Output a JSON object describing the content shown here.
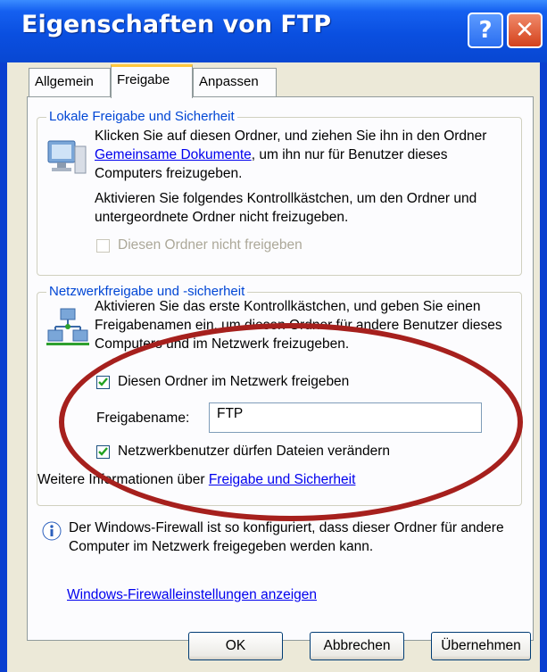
{
  "window": {
    "title": "Eigenschaften von FTP",
    "help_label": "?",
    "close_label": "✕"
  },
  "tabs": [
    {
      "label": "Allgemein",
      "active": false
    },
    {
      "label": "Freigabe",
      "active": true
    },
    {
      "label": "Anpassen",
      "active": false
    }
  ],
  "local_group": {
    "legend": "Lokale Freigabe und Sicherheit",
    "para1_before": "Klicken Sie auf diesen Ordner, und ziehen Sie ihn in den Ordner ",
    "para1_link": "Gemeinsame Dokumente",
    "para1_after": ", um ihn nur für Benutzer dieses Computers freizugeben.",
    "para2": "Aktivieren Sie folgendes Kontrollkästchen, um den Ordner und untergeordnete Ordner nicht freizugeben.",
    "checkbox_label": "Diesen Ordner nicht freigeben",
    "checkbox_checked": false,
    "checkbox_disabled": true
  },
  "network_group": {
    "legend": "Netzwerkfreigabe und -sicherheit",
    "para": "Aktivieren Sie das erste Kontrollkästchen, und geben Sie einen Freigabenamen ein, um diesen Ordner für andere Benutzer dieses Computers und im Netzwerk freizugeben.",
    "share_checkbox_label": "Diesen Ordner im Netzwerk freigeben",
    "share_checked": true,
    "share_name_label": "Freigabename:",
    "share_name_value": "FTP",
    "modify_checkbox_label": "Netzwerkbenutzer dürfen Dateien verändern",
    "modify_checked": true,
    "more_info_prefix": "Weitere Informationen über ",
    "more_info_link": "Freigabe und Sicherheit"
  },
  "firewall": {
    "info_text": "Der Windows-Firewall ist so konfiguriert, dass dieser Ordner für andere Computer im Netzwerk freigegeben werden kann.",
    "settings_link": "Windows-Firewalleinstellungen anzeigen"
  },
  "buttons": {
    "ok": "OK",
    "cancel": "Abbrechen",
    "apply": "Übernehmen"
  },
  "colors": {
    "titlebar": "#0a4fe0",
    "legend": "#0046d5",
    "highlight_ellipse": "#a6201d",
    "check": "#21a121"
  }
}
